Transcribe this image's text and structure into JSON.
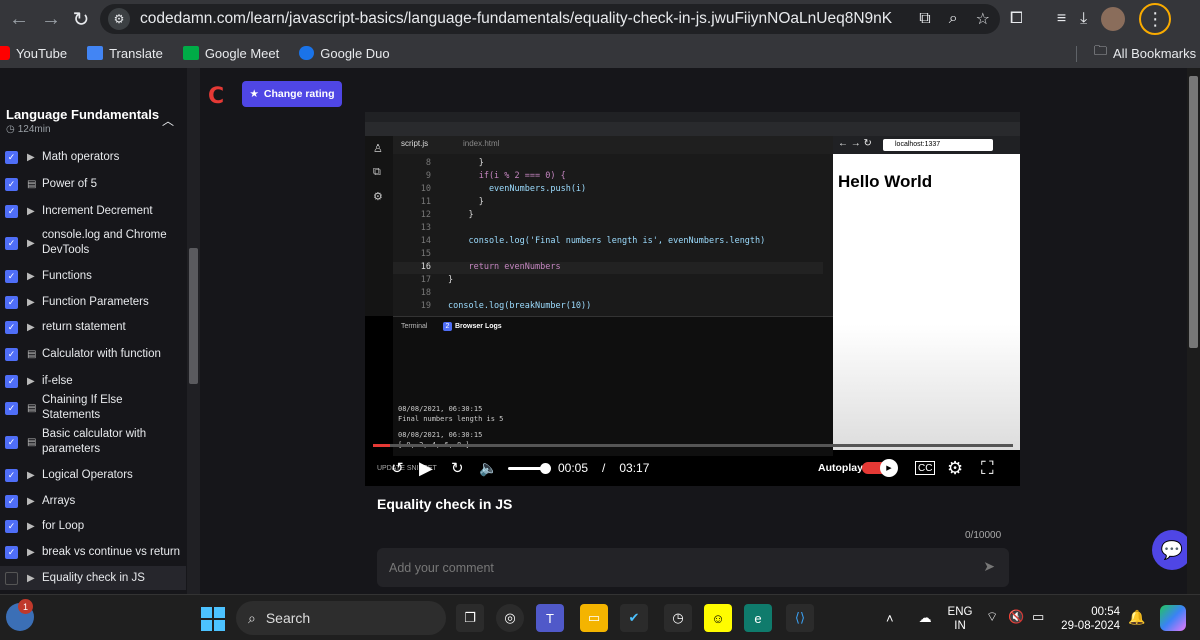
{
  "browser": {
    "url": "codedamn.com/learn/javascript-basics/language-fundamentals/equality-check-in-js.jwuFiiynNOaLnUeq8N9nK",
    "bookmarks": [
      "YouTube",
      "Translate",
      "Google Meet",
      "Google Duo"
    ],
    "all_bookmarks": "All Bookmarks"
  },
  "sidebar": {
    "title": "Language Fundamentals",
    "duration": "124min",
    "lessons": [
      {
        "label": "Math operators",
        "type": "video",
        "done": true
      },
      {
        "label": "Power of 5",
        "type": "exercise",
        "done": true
      },
      {
        "label": "Increment Decrement",
        "type": "video",
        "done": true
      },
      {
        "label": "console.log and Chrome DevTools",
        "type": "video",
        "done": true
      },
      {
        "label": "Functions",
        "type": "video",
        "done": true
      },
      {
        "label": "Function Parameters",
        "type": "video",
        "done": true
      },
      {
        "label": "return statement",
        "type": "video",
        "done": true
      },
      {
        "label": "Calculator with function",
        "type": "exercise",
        "done": true
      },
      {
        "label": "if-else",
        "type": "video",
        "done": true
      },
      {
        "label": "Chaining If Else Statements",
        "type": "exercise",
        "done": true
      },
      {
        "label": "Basic calculator with parameters",
        "type": "exercise",
        "done": true
      },
      {
        "label": "Logical Operators",
        "type": "video",
        "done": true
      },
      {
        "label": "Arrays",
        "type": "video",
        "done": true
      },
      {
        "label": "for Loop",
        "type": "video",
        "done": true
      },
      {
        "label": "break vs continue vs return",
        "type": "video",
        "done": true
      },
      {
        "label": "Equality check in JS",
        "type": "video",
        "done": false
      }
    ]
  },
  "main": {
    "rate_button": "Change rating",
    "lesson_title": "Equality check in JS",
    "char_count": "0/10000",
    "comment_placeholder": "Add your comment"
  },
  "video": {
    "file_tabs": [
      "script.js",
      "index.html"
    ],
    "code_lines": [
      {
        "n": "8",
        "text": "      }"
      },
      {
        "n": "9",
        "text": "      if(i % 2 === 0) {"
      },
      {
        "n": "10",
        "text": "        evenNumbers.push(i)"
      },
      {
        "n": "11",
        "text": "      }"
      },
      {
        "n": "12",
        "text": "    }"
      },
      {
        "n": "13",
        "text": ""
      },
      {
        "n": "14",
        "text": "    console.log('Final numbers length is', evenNumbers.length)"
      },
      {
        "n": "15",
        "text": ""
      },
      {
        "n": "16",
        "text": "    return evenNumbers"
      },
      {
        "n": "17",
        "text": "}"
      },
      {
        "n": "18",
        "text": ""
      },
      {
        "n": "19",
        "text": "console.log(breakNumber(10))"
      }
    ],
    "panel_tabs": [
      "Terminal",
      "Browser Logs"
    ],
    "logs_badge": "2",
    "logs": [
      {
        "time": "08/08/2021, 06:30:15",
        "msg": "Final numbers length is 5"
      },
      {
        "time": "08/08/2021, 06:30:15",
        "msg": "[ 0, 2, 4, 6, 8 ]"
      }
    ],
    "preview_url": "localhost:1337",
    "preview_heading": "Hello World",
    "current_time": "00:05",
    "separator": "/",
    "duration": "03:17",
    "progress": 0.026,
    "autoplay": "Autoplay",
    "update_snippet": "UPDATE SNIPPET"
  },
  "taskbar": {
    "search": "Search",
    "weather_badge": "1",
    "lang_line1": "ENG",
    "lang_line2": "IN",
    "time": "00:54",
    "date": "29-08-2024"
  }
}
